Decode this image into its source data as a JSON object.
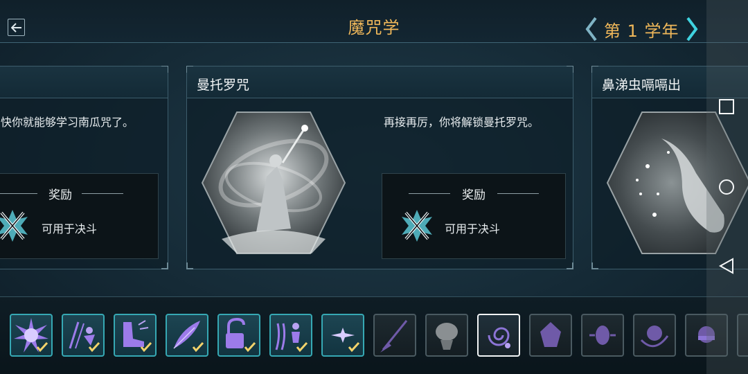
{
  "header": {
    "title": "魔咒学",
    "year_label": "第 1 学年",
    "back_icon": "back-arrow-icon",
    "accent_color": "#f0b85a"
  },
  "cards": [
    {
      "title": "",
      "description": "快你就能够学习南瓜咒了。",
      "reward_heading": "奖励",
      "reward_text": "可用于决斗",
      "reward_icon": "crossed-wands-icon"
    },
    {
      "title": "曼托罗咒",
      "description": "再接再厉，你将解锁曼托罗咒。",
      "reward_heading": "奖励",
      "reward_text": "可用于决斗",
      "reward_icon": "crossed-wands-icon",
      "art_icon": "wizard-casting-spell-art"
    },
    {
      "title": "鼻涕虫嗝嗝出",
      "art_icon": "slug-spell-art"
    }
  ],
  "spell_slots": [
    {
      "icon": "burst-spell-icon",
      "state": "learned"
    },
    {
      "icon": "blast-figure-spell-icon",
      "state": "learned"
    },
    {
      "icon": "boot-spell-icon",
      "state": "learned"
    },
    {
      "icon": "feather-spell-icon",
      "state": "learned"
    },
    {
      "icon": "unlock-spell-icon",
      "state": "learned"
    },
    {
      "icon": "levitate-figure-spell-icon",
      "state": "learned"
    },
    {
      "icon": "sparkle-spell-icon",
      "state": "learned"
    },
    {
      "icon": "broom-spell-icon",
      "state": "locked"
    },
    {
      "icon": "pumpkin-head-spell-icon",
      "state": "locked"
    },
    {
      "icon": "swirl-spell-icon",
      "state": "selected"
    },
    {
      "icon": "gem-spell-icon",
      "state": "locked"
    },
    {
      "icon": "disc-spell-icon",
      "state": "locked"
    },
    {
      "icon": "face-swirl-spell-icon",
      "state": "locked"
    },
    {
      "icon": "face-bandana-spell-icon",
      "state": "locked"
    },
    {
      "icon": "partial-slot-icon",
      "state": "locked"
    }
  ],
  "navbar": {
    "recents_icon": "square-recents-icon",
    "home_icon": "circle-home-icon",
    "back_icon": "triangle-back-icon"
  }
}
